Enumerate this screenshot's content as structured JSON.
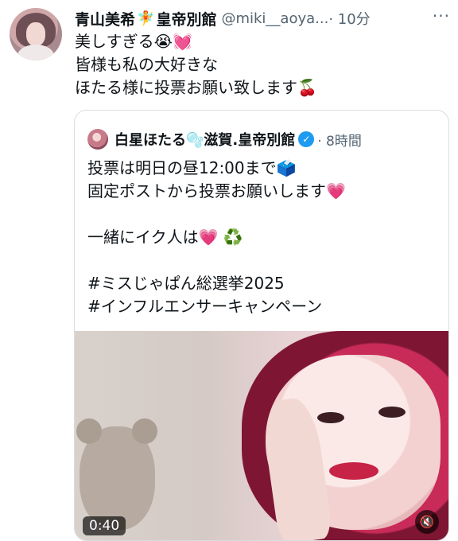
{
  "tweet": {
    "author_name": "青山美希",
    "emoji_fairy": "🧚",
    "author_tag": "皇帝別館",
    "handle": "@miki__aoya...",
    "time": "· 10分",
    "more": "···",
    "lines": [
      "美しすぎる😭💓",
      "皆様も私の大好きな",
      "ほたる様に投票お願い致します🍒"
    ]
  },
  "quote": {
    "author_name": "白星ほたる🫧滋賀.皇帝別館",
    "verified": "✓",
    "time": "· 8時間",
    "lines": [
      "投票は明日の昼12:00まで🗳️",
      "固定ポストから投票お願いします💗",
      "",
      "一緒にイク人は💗 ♻️",
      "",
      " #ミスじゃぱん総選挙2025",
      "#インフルエンサーキャンペーン"
    ],
    "media": {
      "duration": "0:40",
      "mute_icon": "🔇"
    }
  }
}
